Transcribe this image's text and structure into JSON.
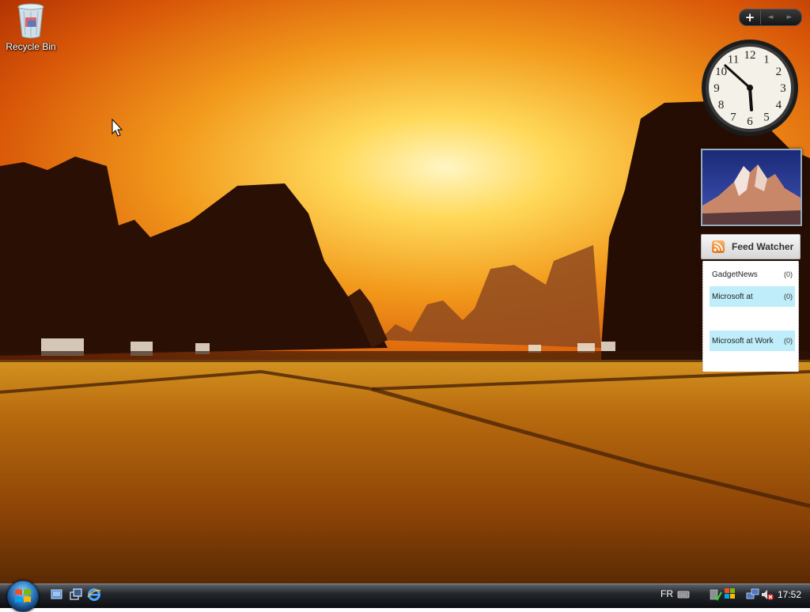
{
  "desktop": {
    "recycle_bin_label": "Recycle Bin"
  },
  "sidebar_controls": {
    "add_label": "+",
    "prev_label": "◄",
    "next_label": "►"
  },
  "clock": {
    "numbers": [
      "12",
      "1",
      "2",
      "3",
      "4",
      "5",
      "6",
      "7",
      "8",
      "9",
      "10",
      "11"
    ],
    "hour": 5,
    "minute": 52
  },
  "feed_watcher": {
    "title": "Feed Watcher",
    "items": [
      {
        "name": "GadgetNews",
        "count": "(0)",
        "highlighted": false
      },
      {
        "name": "Microsoft at",
        "count": "(0)",
        "highlighted": true
      },
      {
        "name": "",
        "count": "",
        "highlighted": false
      },
      {
        "name": "Microsoft at Work",
        "count": "(0)",
        "highlighted": true
      }
    ]
  },
  "taskbar": {
    "quick_launch": [
      "show-desktop-icon",
      "switch-windows-icon",
      "internet-explorer-icon"
    ],
    "language": "FR",
    "time": "17:52"
  }
}
